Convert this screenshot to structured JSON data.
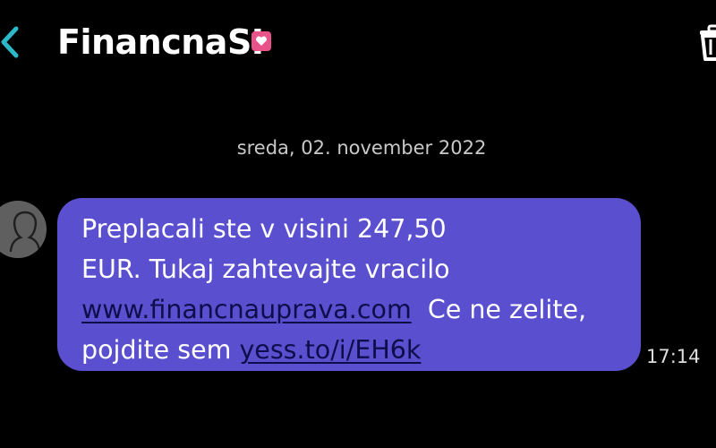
{
  "header": {
    "contact_name": "FinancnaSI",
    "back_icon": "chevron-left-icon",
    "badge_icon": "heart-badge-icon",
    "delete_icon": "trash-icon"
  },
  "conversation": {
    "date_separator": "sreda, 02. november 2022",
    "messages": [
      {
        "sender": "FinancnaSI",
        "avatar_icon": "person-silhouette-icon",
        "lines": [
          {
            "text": "Preplacali ste v visini 247,50"
          },
          {
            "text": "EUR. Tukaj zahtevajte vracilo"
          },
          {
            "link": "www.financnauprava.com",
            "text_after": "  Ce ne zelite,"
          },
          {
            "text_before": "pojdite sem ",
            "link": "yess.to/i/EH6k"
          }
        ],
        "time": "17:14"
      }
    ]
  },
  "colors": {
    "background": "#000000",
    "bubble": "#5a4fcf",
    "link": "#0e0e4a",
    "accent_back": "#2bb8c9",
    "badge": "#e8548a",
    "avatar": "#5f5f5f",
    "date_text": "#c9c9c9"
  }
}
